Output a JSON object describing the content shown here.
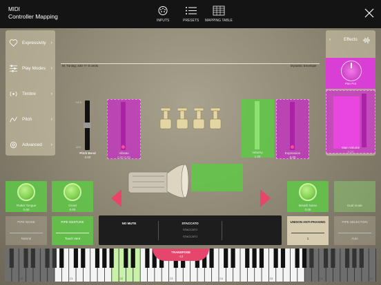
{
  "header": {
    "title_line1": "MIDI",
    "title_line2": "Controller Mapping",
    "nav": [
      {
        "label": "INPUTS",
        "icon": "midi-port-icon"
      },
      {
        "label": "PRESETS",
        "icon": "list-icon"
      },
      {
        "label": "MAPPING TABLE",
        "icon": "grid-icon"
      }
    ],
    "close_icon": "close-icon"
  },
  "sidebar": {
    "items": [
      {
        "label": "Expressivity",
        "icon": "heart-icon"
      },
      {
        "label": "Play Modes",
        "icon": "sliders-icon"
      },
      {
        "label": "Timbre",
        "icon": "radio-wave-icon"
      },
      {
        "label": "Pitch",
        "icon": "pitch-icon"
      },
      {
        "label": "Advanced",
        "icon": "gear-icon"
      }
    ]
  },
  "effects": {
    "title": "Effects",
    "back": "‹"
  },
  "status": {
    "tuning": "M. Tuning: 440  +/- 0 cents",
    "envelope": "Dynamic Envelope"
  },
  "controls": {
    "pitch_bend": {
      "label": "Pitch Bend",
      "value": "0.00",
      "scale_top": "+12.0",
      "scale_bottom": "-12.0"
    },
    "vibrato": {
      "label": "Vibrato",
      "value": "0.00  0.00"
    },
    "velocity": {
      "label": "Velocity",
      "value": "1.00"
    },
    "expression": {
      "label": "Expression",
      "value": "0.00"
    },
    "pan_pot": {
      "label": "Pan Pot"
    },
    "main_volume": {
      "label": "Main Volume",
      "value": "0.00"
    },
    "flutter_tongue": {
      "label": "Flutter Tongue",
      "value": "0.00"
    },
    "growl": {
      "label": "Growl",
      "value": "0.00"
    },
    "breath_noise": {
      "label": "Breath Noise",
      "value": "0.00"
    },
    "dual_mode": {
      "label": "Dual mode"
    },
    "pipe_noise": {
      "label": "PIPE NOISE",
      "value": "Natural"
    },
    "pipe_gesture": {
      "label": "PIPE GESTURE",
      "value": "Touch Vent"
    },
    "unison": {
      "label": "UNISON ANTI-PHASING",
      "value": "1"
    },
    "pipe_selection": {
      "label": "PIPE SELECTION",
      "value": "Auto"
    }
  },
  "articulation": {
    "left": "NO MUTE",
    "middle": "STACCATO",
    "middle_sub1": "STACCATO",
    "middle_sub2": "STACCATO"
  },
  "transpose": {
    "label": "TRANSPOSE",
    "value": "-12"
  },
  "keyboard": {
    "octave_labels": [
      "C0",
      "C1",
      "C2",
      "C3",
      "C4",
      "C5",
      "C6",
      "C7"
    ]
  }
}
